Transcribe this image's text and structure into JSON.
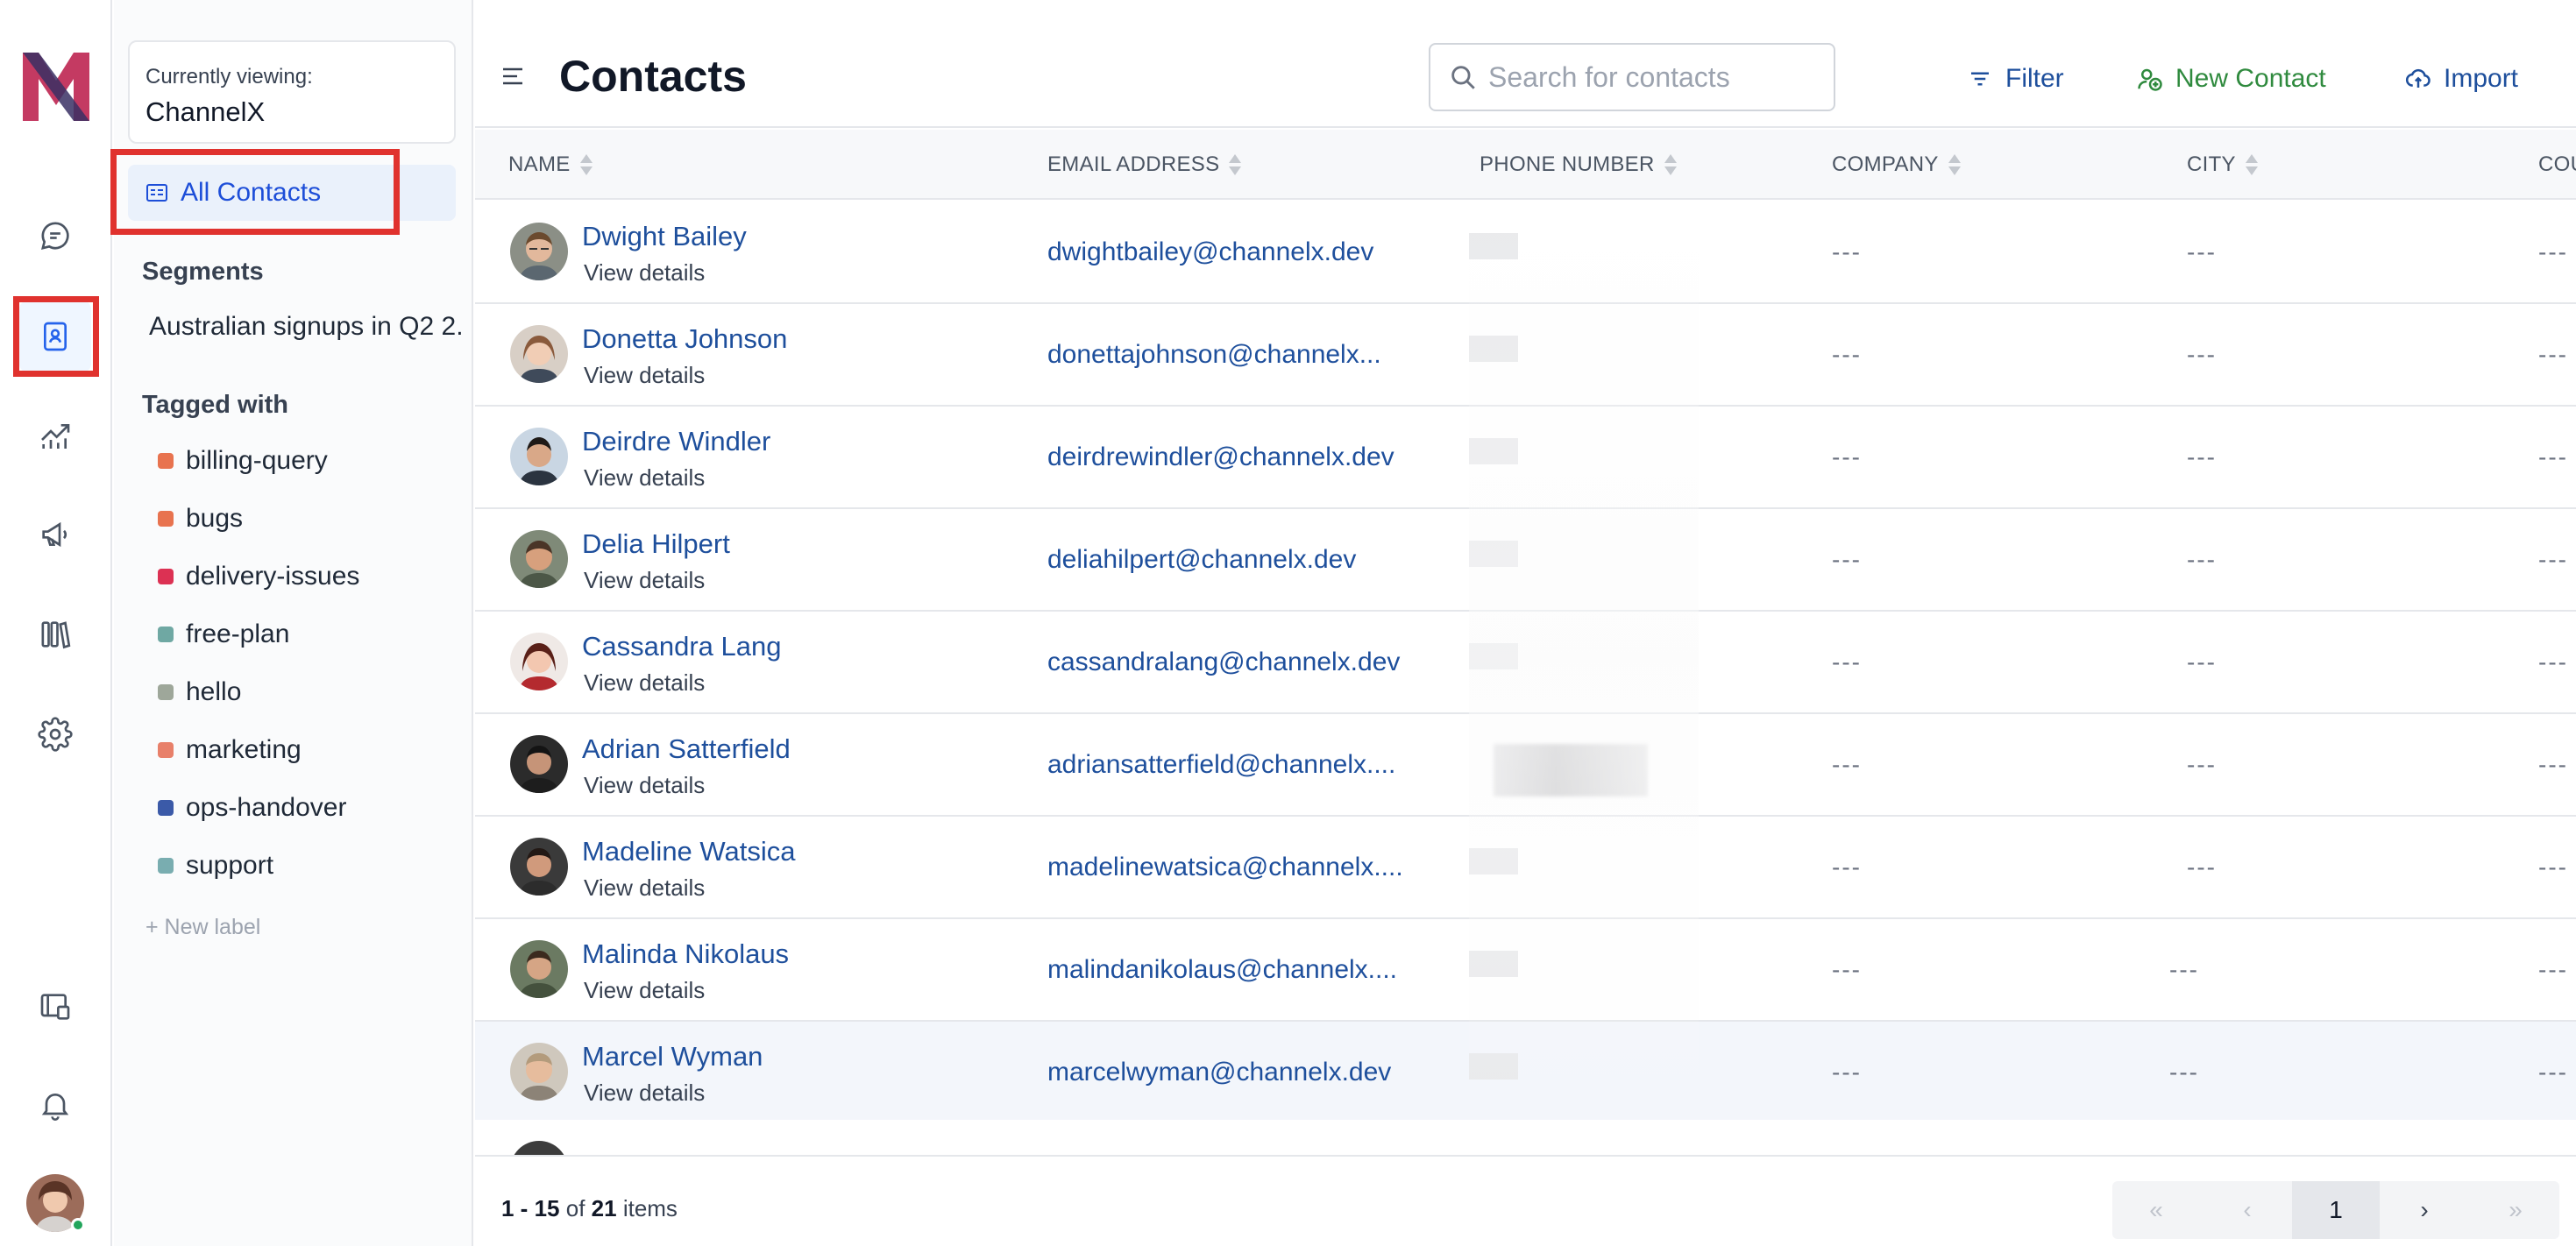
{
  "app": {
    "name": "ChannelX",
    "brand_color": "#c0325a",
    "accent_color": "#1e4f9c",
    "highlight_color": "#e0322e"
  },
  "rail": {
    "items": [
      {
        "name": "conversations",
        "icon": "chat-bubble-icon"
      },
      {
        "name": "contacts",
        "icon": "contact-book-icon",
        "active": true
      },
      {
        "name": "reports",
        "icon": "chart-line-icon"
      },
      {
        "name": "campaigns",
        "icon": "megaphone-icon"
      },
      {
        "name": "library",
        "icon": "library-icon"
      },
      {
        "name": "settings",
        "icon": "gear-icon"
      }
    ],
    "bottom": [
      {
        "name": "portal",
        "icon": "portal-icon"
      },
      {
        "name": "notifications",
        "icon": "bell-icon"
      }
    ]
  },
  "sidebar": {
    "viewing_label": "Currently viewing:",
    "viewing_value": "ChannelX",
    "all_contacts": "All Contacts",
    "segments_title": "Segments",
    "segments": [
      "Australian signups in Q2 2."
    ],
    "tags_title": "Tagged with",
    "tags": [
      {
        "label": "billing-query",
        "color": "#e8734f"
      },
      {
        "label": "bugs",
        "color": "#e8734f"
      },
      {
        "label": "delivery-issues",
        "color": "#dc3153"
      },
      {
        "label": "free-plan",
        "color": "#6fa8a3"
      },
      {
        "label": "hello",
        "color": "#9ea79a"
      },
      {
        "label": "marketing",
        "color": "#e8806a"
      },
      {
        "label": "ops-handover",
        "color": "#3b5aa8"
      },
      {
        "label": "support",
        "color": "#79adb0"
      }
    ],
    "new_label": "+ New label"
  },
  "header": {
    "title": "Contacts",
    "search_placeholder": "Search for contacts",
    "filter": "Filter",
    "new_contact": "New Contact",
    "import": "Import"
  },
  "table": {
    "columns": [
      "NAME",
      "EMAIL ADDRESS",
      "PHONE NUMBER",
      "COMPANY",
      "CITY",
      "COU"
    ],
    "view_details": "View details",
    "rows": [
      {
        "name": "Dwight Bailey",
        "email": "dwightbailey@channelx.dev",
        "company": "---",
        "city": "---",
        "country": "---"
      },
      {
        "name": "Donetta Johnson",
        "email": "donettajohnson@channelx...",
        "company": "---",
        "city": "---",
        "country": "---"
      },
      {
        "name": "Deirdre Windler",
        "email": "deirdrewindler@channelx.dev",
        "company": "---",
        "city": "---",
        "country": "---"
      },
      {
        "name": "Delia Hilpert",
        "email": "deliahilpert@channelx.dev",
        "company": "---",
        "city": "---",
        "country": "---"
      },
      {
        "name": "Cassandra Lang",
        "email": "cassandralang@channelx.dev",
        "company": "---",
        "city": "---",
        "country": "---"
      },
      {
        "name": "Adrian Satterfield",
        "email": "adriansatterfield@channelx....",
        "company": "---",
        "city": "---",
        "country": "---"
      },
      {
        "name": "Madeline Watsica",
        "email": "madelinewatsica@channelx....",
        "company": "---",
        "city": "---",
        "country": "---"
      },
      {
        "name": "Malinda Nikolaus",
        "email": "malindanikolaus@channelx....",
        "company": "---",
        "city": "---",
        "country": "---"
      },
      {
        "name": "Marcel Wyman",
        "email": "marcelwyman@channelx.dev",
        "company": "---",
        "city": "---",
        "country": "---"
      }
    ]
  },
  "footer": {
    "range": "1 - 15",
    "of_text": "of",
    "total": "21",
    "items_text": "items",
    "current_page": "1",
    "first": "«",
    "prev": "‹",
    "next": "›",
    "last": "»"
  }
}
